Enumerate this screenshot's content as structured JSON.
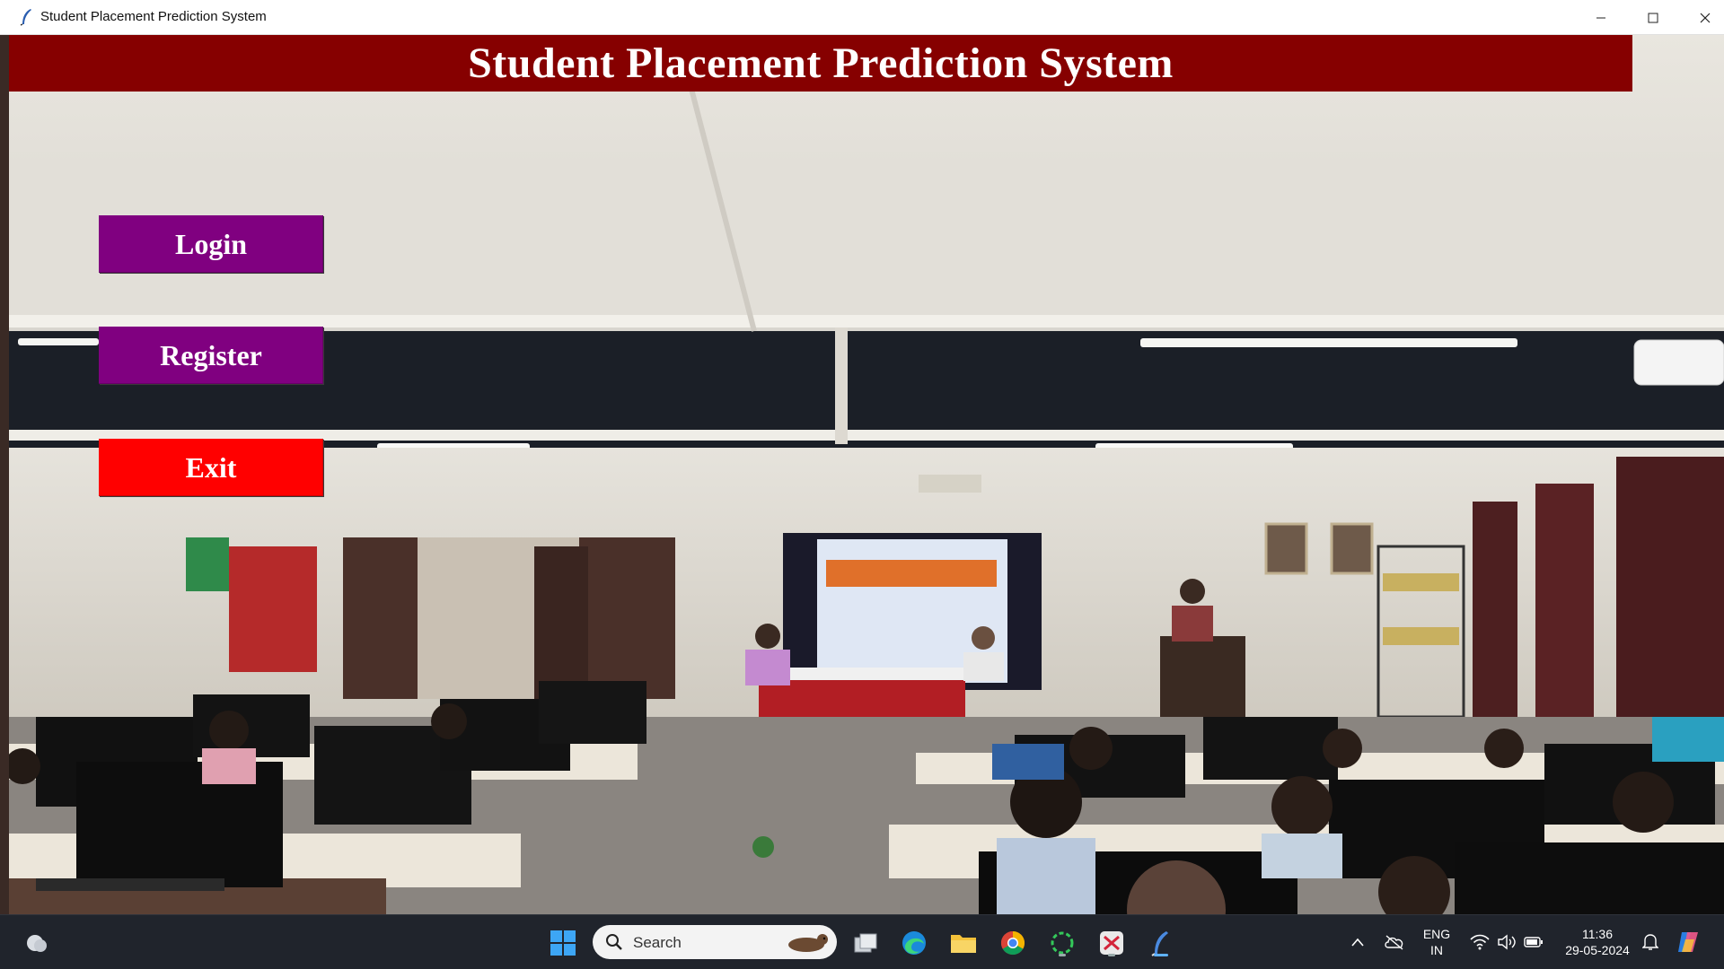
{
  "window": {
    "title": "Student Placement Prediction System",
    "controls": [
      "minimize",
      "maximize",
      "close"
    ]
  },
  "app": {
    "header_title": "Student Placement Prediction System",
    "header_color": "#860000",
    "buttons": {
      "login": "Login",
      "register": "Register",
      "exit": "Exit"
    },
    "button_colors": {
      "login": "#800080",
      "register": "#800080",
      "exit": "#ff0000"
    },
    "background": "photo of a computer lab seminar with rows of monitors and a presentation screen"
  },
  "taskbar": {
    "search_placeholder": "Search",
    "pinned_icons": [
      "weather-icon",
      "start-icon",
      "task-view-icon",
      "edge-icon",
      "file-explorer-icon",
      "chrome-icon",
      "loading-app-icon",
      "snipping-tool-icon",
      "python-feather-icon"
    ],
    "tray": {
      "language_line1": "ENG",
      "language_line2": "IN",
      "time": "11:36",
      "date": "29-05-2024"
    }
  }
}
